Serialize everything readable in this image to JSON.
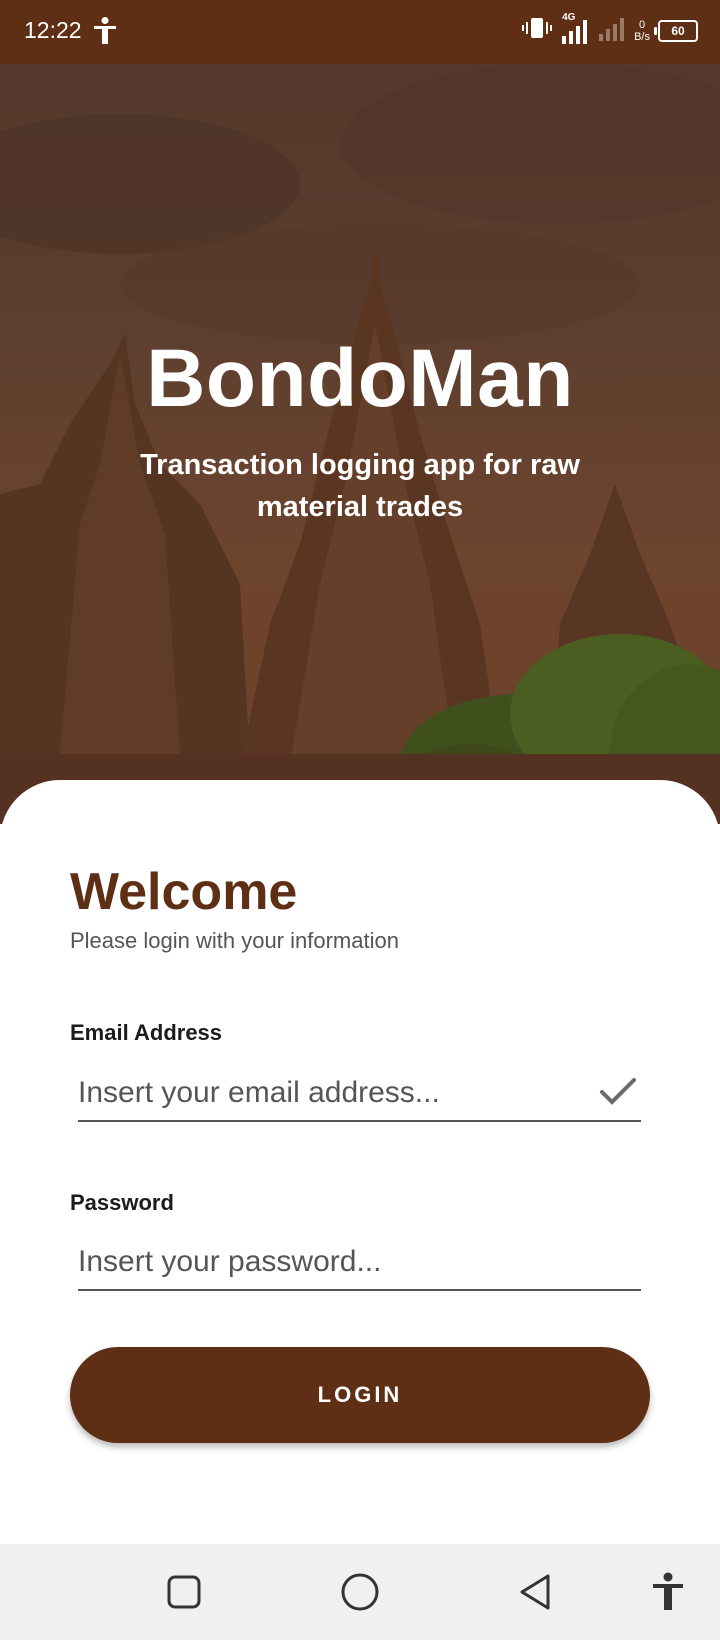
{
  "status_bar": {
    "time": "12:22",
    "network": "4G",
    "speed_value": "0",
    "speed_unit": "B/s",
    "battery": "60"
  },
  "hero": {
    "title": "BondoMan",
    "subtitle": "Transaction logging app for raw material trades"
  },
  "login": {
    "heading": "Welcome",
    "subheading": "Please login with your information",
    "email_label": "Email Address",
    "email_placeholder": "Insert your email address...",
    "password_label": "Password",
    "password_placeholder": "Insert your password...",
    "button_label": "LOGIN"
  },
  "colors": {
    "brand": "#5e2f14",
    "sheet": "#ffffff",
    "nav_bar": "#f0f0f0"
  },
  "icons": {
    "email_status": "check-icon",
    "nav": [
      "recents-square-icon",
      "home-circle-icon",
      "back-triangle-icon",
      "accessibility-icon"
    ]
  }
}
